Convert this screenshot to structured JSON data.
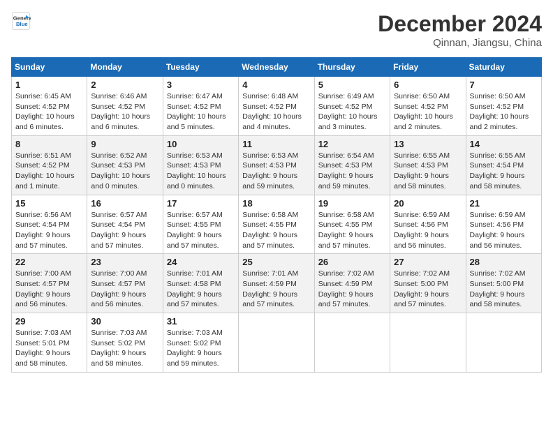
{
  "logo": {
    "line1": "General",
    "line2": "Blue"
  },
  "title": "December 2024",
  "location": "Qinnan, Jiangsu, China",
  "weekdays": [
    "Sunday",
    "Monday",
    "Tuesday",
    "Wednesday",
    "Thursday",
    "Friday",
    "Saturday"
  ],
  "weeks": [
    [
      {
        "day": 1,
        "detail": "Sunrise: 6:45 AM\nSunset: 4:52 PM\nDaylight: 10 hours\nand 6 minutes."
      },
      {
        "day": 2,
        "detail": "Sunrise: 6:46 AM\nSunset: 4:52 PM\nDaylight: 10 hours\nand 6 minutes."
      },
      {
        "day": 3,
        "detail": "Sunrise: 6:47 AM\nSunset: 4:52 PM\nDaylight: 10 hours\nand 5 minutes."
      },
      {
        "day": 4,
        "detail": "Sunrise: 6:48 AM\nSunset: 4:52 PM\nDaylight: 10 hours\nand 4 minutes."
      },
      {
        "day": 5,
        "detail": "Sunrise: 6:49 AM\nSunset: 4:52 PM\nDaylight: 10 hours\nand 3 minutes."
      },
      {
        "day": 6,
        "detail": "Sunrise: 6:50 AM\nSunset: 4:52 PM\nDaylight: 10 hours\nand 2 minutes."
      },
      {
        "day": 7,
        "detail": "Sunrise: 6:50 AM\nSunset: 4:52 PM\nDaylight: 10 hours\nand 2 minutes."
      }
    ],
    [
      {
        "day": 8,
        "detail": "Sunrise: 6:51 AM\nSunset: 4:52 PM\nDaylight: 10 hours\nand 1 minute."
      },
      {
        "day": 9,
        "detail": "Sunrise: 6:52 AM\nSunset: 4:53 PM\nDaylight: 10 hours\nand 0 minutes."
      },
      {
        "day": 10,
        "detail": "Sunrise: 6:53 AM\nSunset: 4:53 PM\nDaylight: 10 hours\nand 0 minutes."
      },
      {
        "day": 11,
        "detail": "Sunrise: 6:53 AM\nSunset: 4:53 PM\nDaylight: 9 hours\nand 59 minutes."
      },
      {
        "day": 12,
        "detail": "Sunrise: 6:54 AM\nSunset: 4:53 PM\nDaylight: 9 hours\nand 59 minutes."
      },
      {
        "day": 13,
        "detail": "Sunrise: 6:55 AM\nSunset: 4:53 PM\nDaylight: 9 hours\nand 58 minutes."
      },
      {
        "day": 14,
        "detail": "Sunrise: 6:55 AM\nSunset: 4:54 PM\nDaylight: 9 hours\nand 58 minutes."
      }
    ],
    [
      {
        "day": 15,
        "detail": "Sunrise: 6:56 AM\nSunset: 4:54 PM\nDaylight: 9 hours\nand 57 minutes."
      },
      {
        "day": 16,
        "detail": "Sunrise: 6:57 AM\nSunset: 4:54 PM\nDaylight: 9 hours\nand 57 minutes."
      },
      {
        "day": 17,
        "detail": "Sunrise: 6:57 AM\nSunset: 4:55 PM\nDaylight: 9 hours\nand 57 minutes."
      },
      {
        "day": 18,
        "detail": "Sunrise: 6:58 AM\nSunset: 4:55 PM\nDaylight: 9 hours\nand 57 minutes."
      },
      {
        "day": 19,
        "detail": "Sunrise: 6:58 AM\nSunset: 4:55 PM\nDaylight: 9 hours\nand 57 minutes."
      },
      {
        "day": 20,
        "detail": "Sunrise: 6:59 AM\nSunset: 4:56 PM\nDaylight: 9 hours\nand 56 minutes."
      },
      {
        "day": 21,
        "detail": "Sunrise: 6:59 AM\nSunset: 4:56 PM\nDaylight: 9 hours\nand 56 minutes."
      }
    ],
    [
      {
        "day": 22,
        "detail": "Sunrise: 7:00 AM\nSunset: 4:57 PM\nDaylight: 9 hours\nand 56 minutes."
      },
      {
        "day": 23,
        "detail": "Sunrise: 7:00 AM\nSunset: 4:57 PM\nDaylight: 9 hours\nand 56 minutes."
      },
      {
        "day": 24,
        "detail": "Sunrise: 7:01 AM\nSunset: 4:58 PM\nDaylight: 9 hours\nand 57 minutes."
      },
      {
        "day": 25,
        "detail": "Sunrise: 7:01 AM\nSunset: 4:59 PM\nDaylight: 9 hours\nand 57 minutes."
      },
      {
        "day": 26,
        "detail": "Sunrise: 7:02 AM\nSunset: 4:59 PM\nDaylight: 9 hours\nand 57 minutes."
      },
      {
        "day": 27,
        "detail": "Sunrise: 7:02 AM\nSunset: 5:00 PM\nDaylight: 9 hours\nand 57 minutes."
      },
      {
        "day": 28,
        "detail": "Sunrise: 7:02 AM\nSunset: 5:00 PM\nDaylight: 9 hours\nand 58 minutes."
      }
    ],
    [
      {
        "day": 29,
        "detail": "Sunrise: 7:03 AM\nSunset: 5:01 PM\nDaylight: 9 hours\nand 58 minutes."
      },
      {
        "day": 30,
        "detail": "Sunrise: 7:03 AM\nSunset: 5:02 PM\nDaylight: 9 hours\nand 58 minutes."
      },
      {
        "day": 31,
        "detail": "Sunrise: 7:03 AM\nSunset: 5:02 PM\nDaylight: 9 hours\nand 59 minutes."
      },
      null,
      null,
      null,
      null
    ]
  ]
}
